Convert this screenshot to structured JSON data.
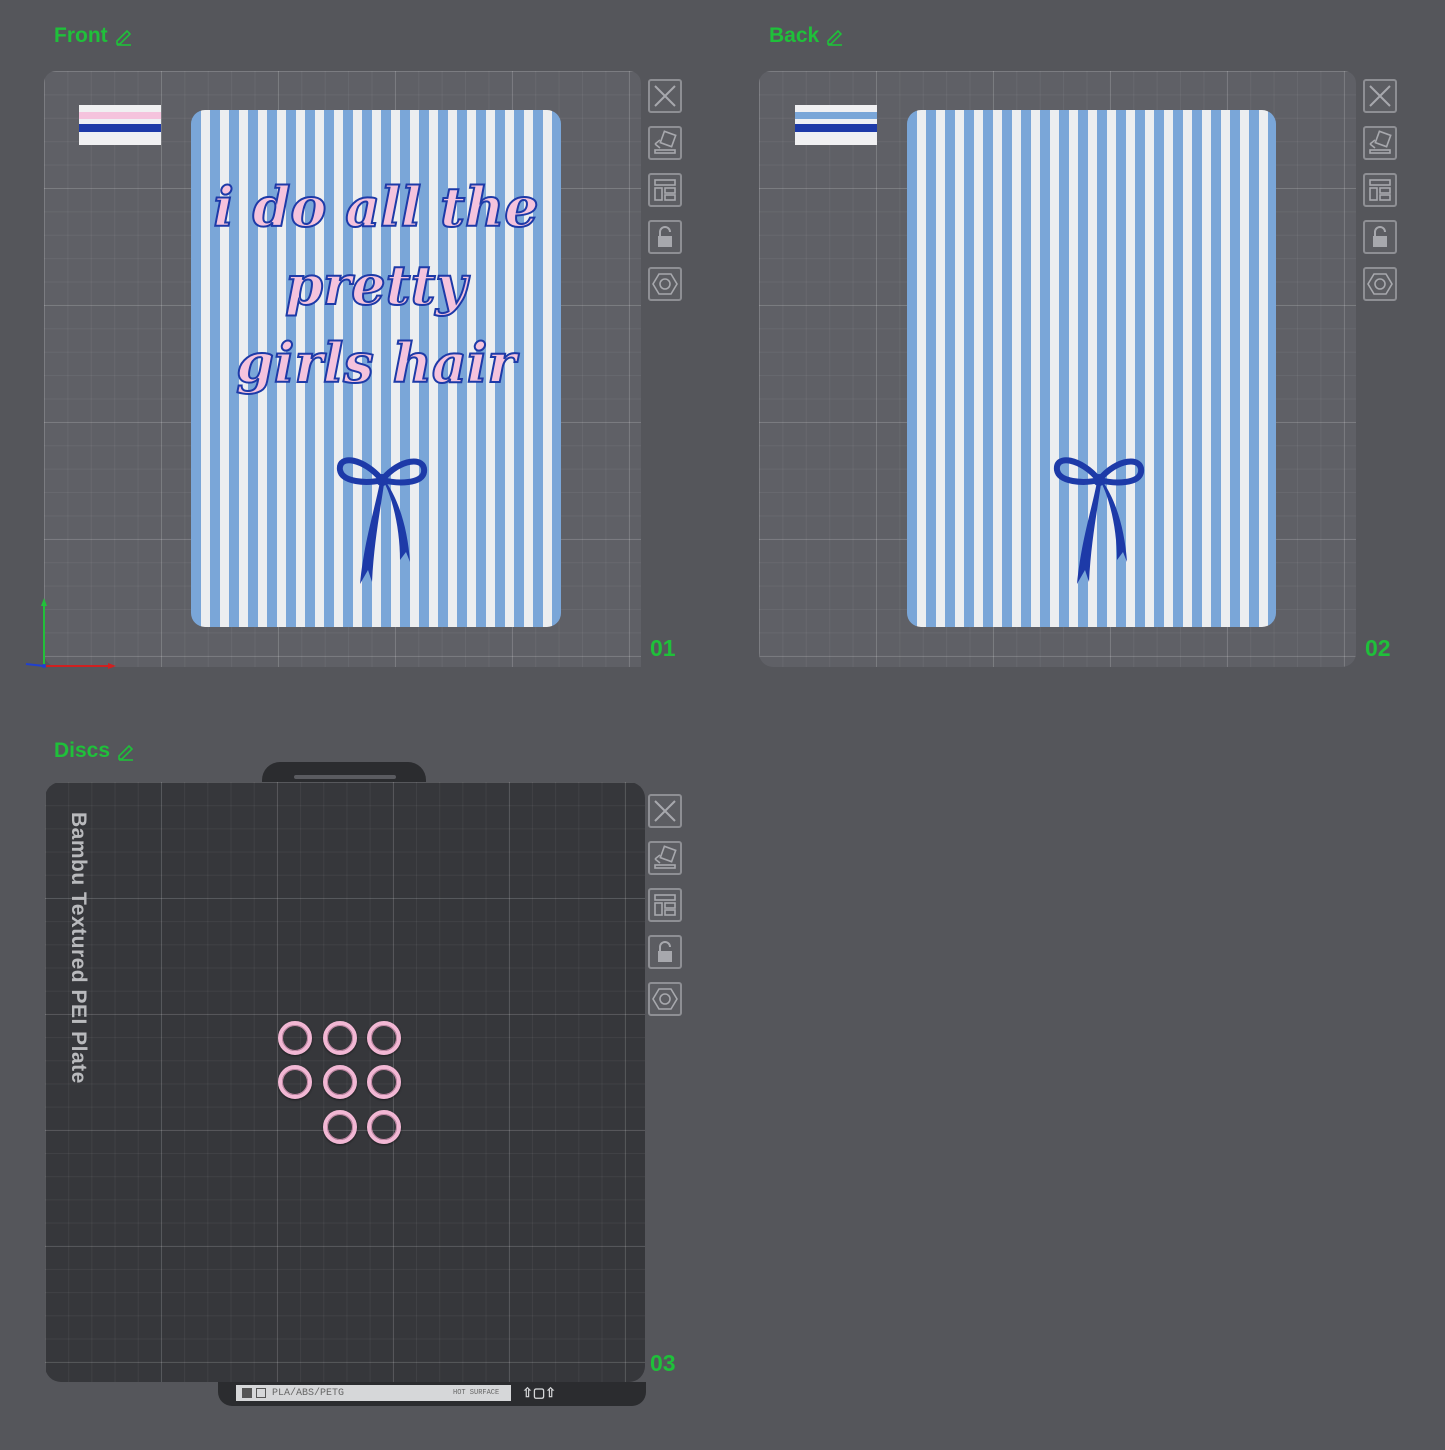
{
  "plates": [
    {
      "title": "Front",
      "number": "01"
    },
    {
      "title": "Back",
      "number": "02"
    },
    {
      "title": "Discs",
      "number": "03"
    }
  ],
  "front_cover_text": [
    "i do all the",
    "pretty",
    "girls hair"
  ],
  "pei_plate_label": "Bambu Textured PEI Plate",
  "plate_strip_text": "PLA/ABS/PETG",
  "plate_strip_warning": "HOT SURFACE",
  "toolbar_icons": [
    "close-icon",
    "auto-orient-icon",
    "arrange-icon",
    "lock-icon",
    "settings-icon"
  ],
  "colors": {
    "accent": "#1fc03a",
    "stripe_blue": "#7aa6d8",
    "stripe_white": "#eceef0",
    "ribbon": "#1d3aa8",
    "disc_pink": "#f2b7d4"
  }
}
